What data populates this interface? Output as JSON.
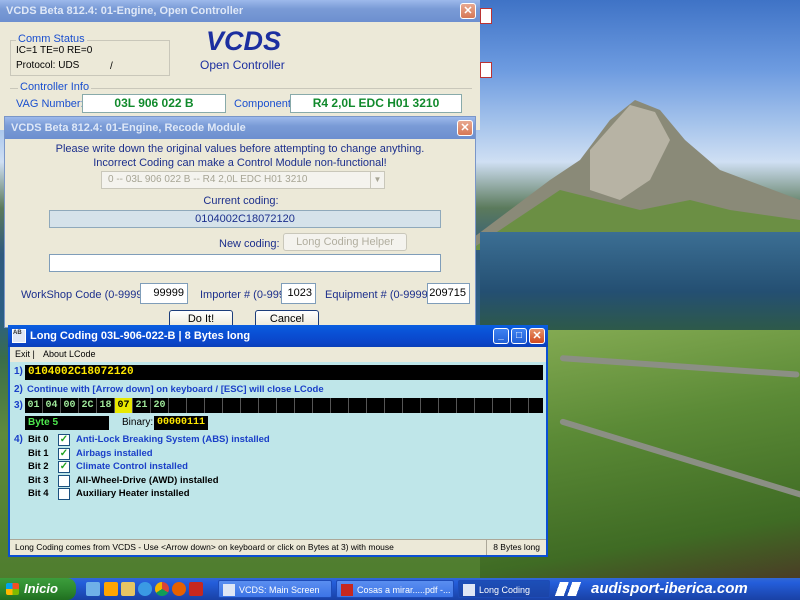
{
  "main_window": {
    "title": "VCDS Beta 812.4: 01-Engine,  Open Controller",
    "comm_status_label": "Comm Status",
    "comm_status_line": "IC=1  TE=0  RE=0",
    "protocol": "Protocol: UDS",
    "protocol_slash": "/",
    "logo": "VCDS",
    "subtitle": "Open Controller",
    "controller_info_label": "Controller Info",
    "vag_number_label": "VAG Number:",
    "vag_number": "03L 906 022 B",
    "component_label": "Component:",
    "component": "R4 2,0L EDC    H01 3210"
  },
  "recode_window": {
    "title": "VCDS Beta 812.4: 01-Engine,  Recode Module",
    "warning_line1": "Please write down the original values before attempting to change anything.",
    "warning_line2": "Incorrect Coding can make a Control Module non-functional!",
    "module_select": "0 -- 03L 906 022 B -- R4 2,0L EDC    H01 3210",
    "current_coding_label": "Current coding:",
    "current_coding": "0104002C18072120",
    "new_coding_label": "New coding:",
    "long_coding_helper": "Long Coding Helper",
    "new_coding_value": "",
    "workshop_label": "WorkShop Code (0-99999):",
    "workshop_value": "99999",
    "importer_label": "Importer # (0-999):",
    "importer_value": "1023",
    "equipment_label": "Equipment # (0-99999):",
    "equipment_value": "209715",
    "do_it": "Do It!",
    "cancel": "Cancel"
  },
  "lcode_window": {
    "title": "Long Coding  03L-906-022-B  |  8 Bytes long",
    "menu": [
      "Exit  |",
      "About LCode"
    ],
    "step1_num": "1)",
    "step1_value": "0104002C18072120",
    "step2_num": "2)",
    "step2_text": "Continue with [Arrow down] on keyboard / [ESC] will close LCode",
    "step3_num": "3)",
    "bytes": [
      "01",
      "04",
      "00",
      "2C",
      "18",
      "07",
      "21",
      "20"
    ],
    "byte_label": "Byte 5",
    "binary_label": "Binary:",
    "binary_value": "00000111",
    "step4_num": "4)",
    "bits": [
      {
        "bit": "Bit 0",
        "label": "Anti-Lock Breaking System (ABS) installed",
        "checked": true,
        "color": "#1a3fc8"
      },
      {
        "bit": "Bit 1",
        "label": "Airbags installed",
        "checked": true,
        "color": "#1a3fc8"
      },
      {
        "bit": "Bit 2",
        "label": "Climate Control installed",
        "checked": true,
        "color": "#1a3fc8"
      },
      {
        "bit": "Bit 3",
        "label": "All-Wheel-Drive (AWD) installed",
        "checked": false,
        "color": "#000000"
      },
      {
        "bit": "Bit 4",
        "label": "Auxiliary Heater installed",
        "checked": false,
        "color": "#000000"
      }
    ],
    "status_text": "Long Coding comes from VCDS - Use <Arrow down> on keyboard or click on Bytes at 3) with mouse",
    "status_right": "8 Bytes long"
  },
  "taskbar": {
    "start": "Inicio",
    "tasks": [
      "VCDS:  Main Screen",
      "Cosas a mirar.....pdf -...",
      "Long Coding"
    ],
    "watermark": "audisport-iberica.com"
  }
}
